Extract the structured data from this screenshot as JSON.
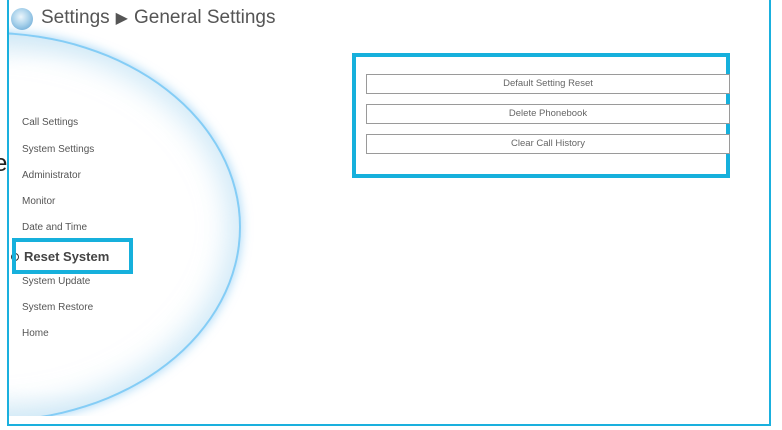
{
  "header": {
    "crumb_root": "Settings",
    "separator": "▶",
    "crumb_current": "General Settings"
  },
  "stray_text": "e",
  "sidebar": {
    "items": [
      {
        "label": "Call Settings"
      },
      {
        "label": "System Settings"
      },
      {
        "label": "Administrator"
      },
      {
        "label": "Monitor"
      },
      {
        "label": "Date and Time"
      },
      {
        "label": "Reset System",
        "active": true
      },
      {
        "label": "System Update"
      },
      {
        "label": "System Restore"
      },
      {
        "label": "Home"
      }
    ]
  },
  "main": {
    "buttons": [
      {
        "label": "Default Setting Reset"
      },
      {
        "label": "Delete Phonebook"
      },
      {
        "label": "Clear Call History"
      }
    ]
  },
  "colors": {
    "highlight": "#16b0dc",
    "frame": "#1ab0de",
    "glow": "#78c8f5"
  },
  "icons": {
    "logo": "logo-orb-icon",
    "separator": "triangle-right-icon",
    "active_marker": "radio-bullet-icon"
  }
}
